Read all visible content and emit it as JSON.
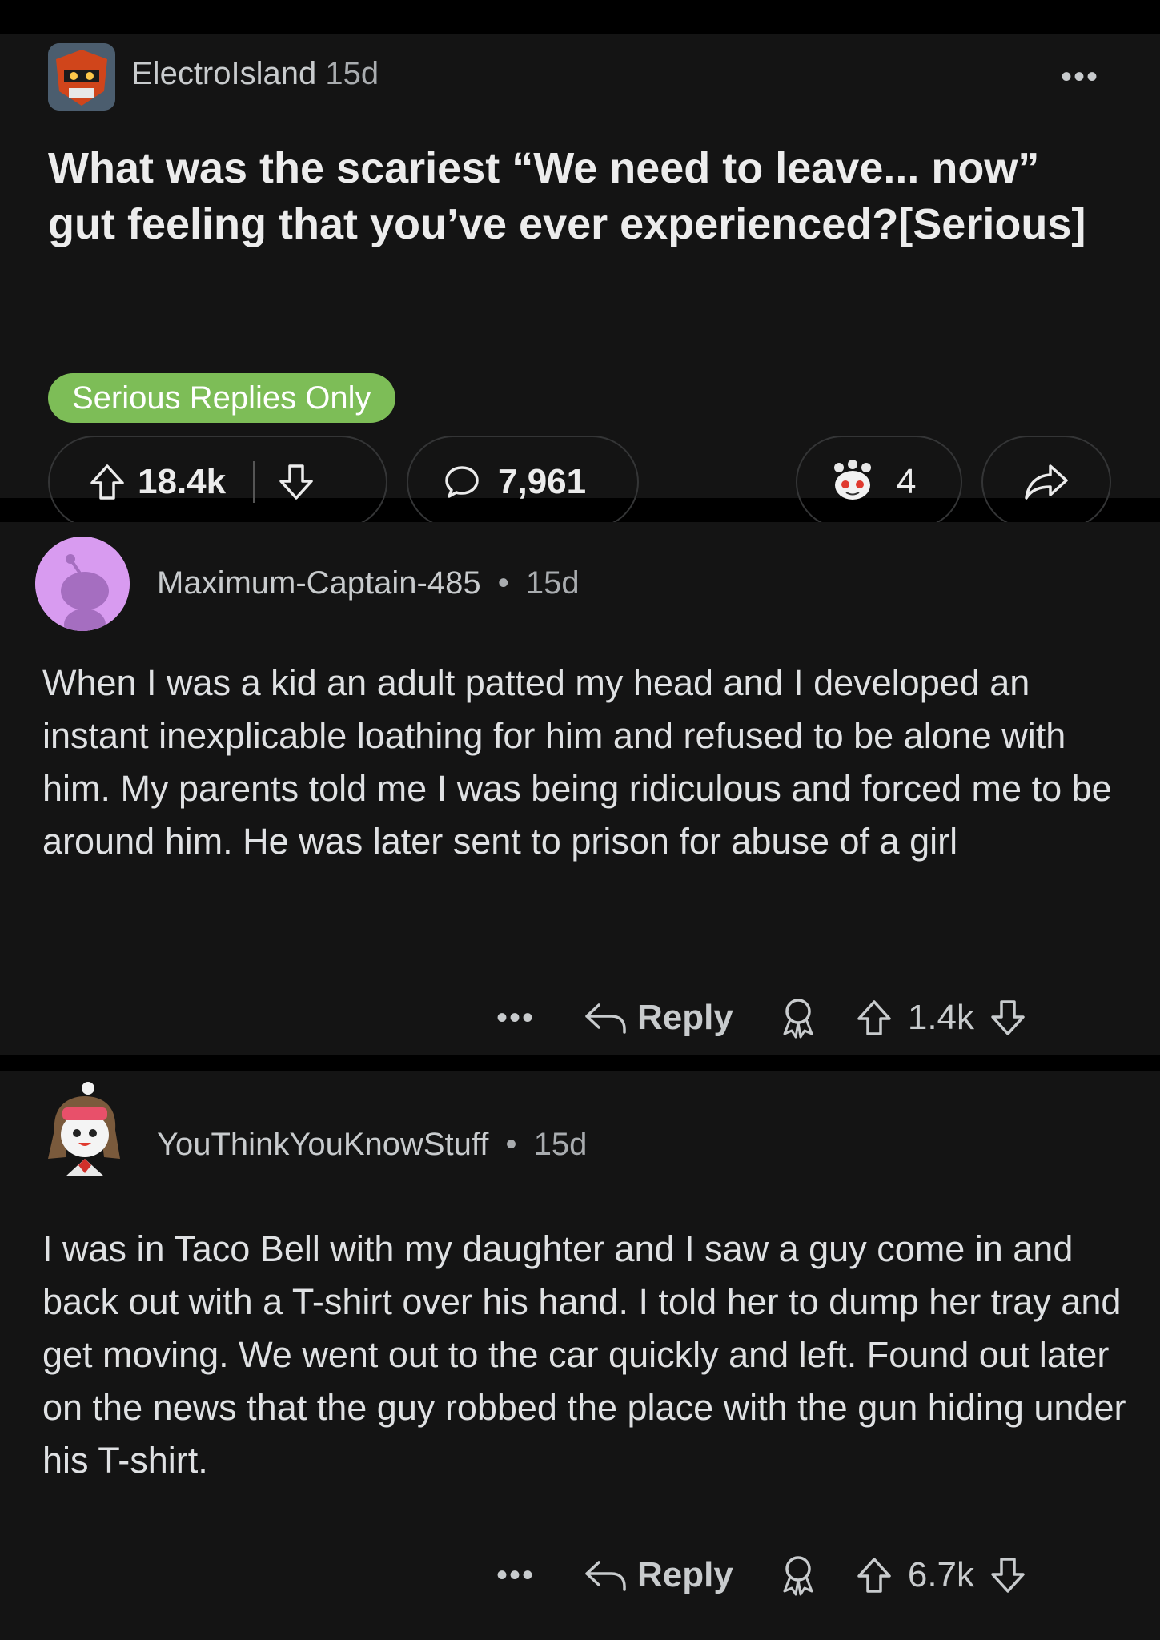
{
  "post": {
    "author": "ElectroIsland",
    "age": "15d",
    "title": "What was the scariest “We need to leave... now” gut feeling that you’ve ever experienced?[Serious]",
    "flair": "Serious Replies Only",
    "upvotes": "18.4k",
    "comments": "7,961",
    "awards": "4",
    "flair_color": "#7dbd57"
  },
  "comments": [
    {
      "author": "Maximum-Captain-485",
      "age": "15d",
      "separator": "•",
      "body": "When I was a kid an adult patted my head and I developed an instant inexplicable loathing for him and refused to be alone with him. My parents told me I was being ridiculous and forced me to be around him. He was later sent to prison for abuse of a girl",
      "reply_label": "Reply",
      "score": "1.4k"
    },
    {
      "author": "YouThinkYouKnowStuff",
      "age": "15d",
      "separator": "•",
      "body": "I was in Taco Bell with my daughter and I saw a guy come in and back out with a T-shirt over his hand. I told her to dump her tray and get moving. We went out to the car quickly and left. Found out later on the news that the guy robbed the place with the gun hiding under his T-shirt.",
      "reply_label": "Reply",
      "score": "6.7k"
    }
  ],
  "icons": [
    "more-icon",
    "upvote-icon",
    "downvote-icon",
    "comment-icon",
    "award-icon",
    "share-icon",
    "reply-icon"
  ]
}
